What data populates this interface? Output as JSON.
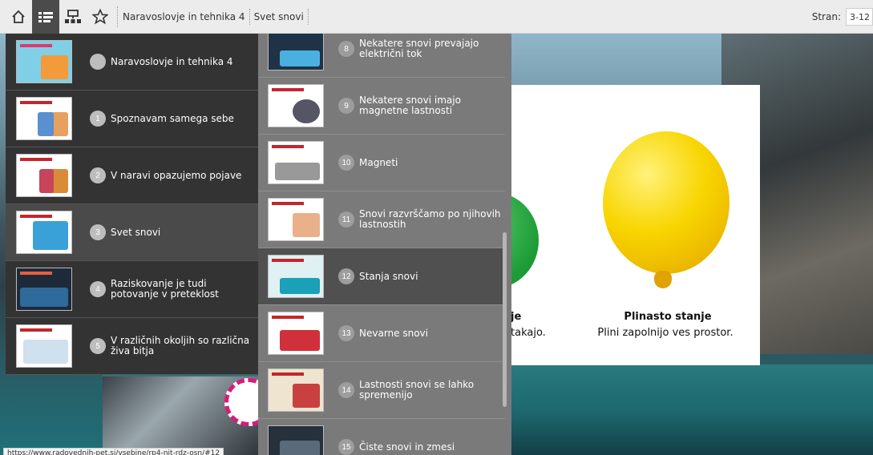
{
  "toolbar": {
    "breadcrumb": [
      "Naravoslovje in tehnika 4",
      "Svet snovi"
    ],
    "pages_label": "Stran:",
    "pages_value": "3-12"
  },
  "card": {
    "left_title": "je",
    "left_text": "takajo.",
    "title": "Plinasto stanje",
    "text": "Plini zapolnijo ves prostor."
  },
  "toc_left": [
    {
      "num": "",
      "label": "Naravoslovje in tehnika 4"
    },
    {
      "num": "1",
      "label": "Spoznavam samega sebe"
    },
    {
      "num": "2",
      "label": "V naravi opazujemo pojave"
    },
    {
      "num": "3",
      "label": "Svet snovi"
    },
    {
      "num": "4",
      "label": "Raziskovanje je tudi potovanje v preteklost"
    },
    {
      "num": "5",
      "label": "V različnih okoljih so različna živa bitja"
    }
  ],
  "toc_right": [
    {
      "num": "8",
      "label": "Nekatere snovi prevajajo električni tok"
    },
    {
      "num": "9",
      "label": "Nekatere snovi imajo magnetne lastnosti"
    },
    {
      "num": "10",
      "label": "Magneti"
    },
    {
      "num": "11",
      "label": "Snovi razvrščamo po njihovih lastnostih"
    },
    {
      "num": "12",
      "label": "Stanja snovi"
    },
    {
      "num": "13",
      "label": "Nevarne snovi"
    },
    {
      "num": "14",
      "label": "Lastnosti snovi se lahko spremenijo"
    },
    {
      "num": "15",
      "label": "Čiste snovi in zmesi"
    }
  ],
  "status_url": "https://www.radovednih-pet.si/vsebine/rp4-nit-rdz-osn/#12"
}
